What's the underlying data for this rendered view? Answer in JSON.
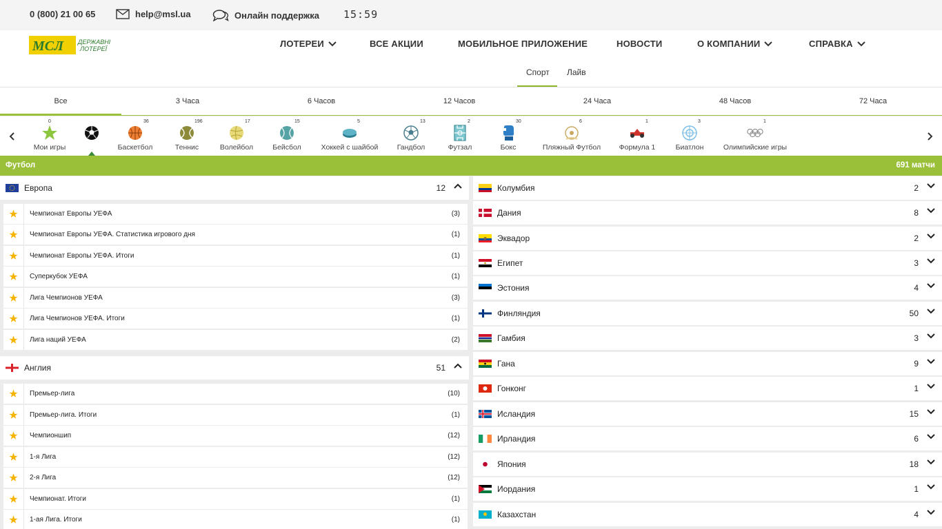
{
  "topbar": {
    "phone": "0 (800) 21 00 65",
    "email": "help@msl.ua",
    "support": "Онлайн поддержка",
    "time": "15:59"
  },
  "logo": {
    "mark": "МСЛ",
    "line1": "ДЕРЖАВНІ",
    "line2": "ЛОТЕРЕЇ"
  },
  "nav": {
    "lotteries": "ЛОТЕРЕИ",
    "promos": "ВСЕ АКЦИИ",
    "mobile": "МОБИЛЬНОЕ ПРИЛОЖЕНИЕ",
    "news": "НОВОСТИ",
    "company": "О КОМПАНИИ",
    "help": "СПРАВКА"
  },
  "modes": {
    "sport": "Спорт",
    "live": "Лайв"
  },
  "timeframes": [
    "Все",
    "3 Часа",
    "6 Часов",
    "12 Часов",
    "24 Часа",
    "48 Часов",
    "72 Часа"
  ],
  "sports": [
    {
      "label": "Мои игры",
      "count": "0",
      "icon": "star-icon"
    },
    {
      "label": "",
      "count": "",
      "icon": "soccer-ball-icon"
    },
    {
      "label": "Баскетбол",
      "count": "36",
      "icon": "basketball-icon"
    },
    {
      "label": "Теннис",
      "count": "196",
      "icon": "tennis-ball-icon"
    },
    {
      "label": "Волейбол",
      "count": "17",
      "icon": "volleyball-icon"
    },
    {
      "label": "Бейсбол",
      "count": "15",
      "icon": "baseball-icon"
    },
    {
      "label": "Хоккей с шайбой",
      "count": "5",
      "icon": "hockey-puck-icon"
    },
    {
      "label": "Гандбол",
      "count": "13",
      "icon": "handball-icon"
    },
    {
      "label": "Футзал",
      "count": "2",
      "icon": "futsal-icon"
    },
    {
      "label": "Бокс",
      "count": "30",
      "icon": "boxing-glove-icon"
    },
    {
      "label": "Пляжный Футбол",
      "count": "6",
      "icon": "beach-soccer-icon"
    },
    {
      "label": "Формула 1",
      "count": "1",
      "icon": "formula1-car-icon"
    },
    {
      "label": "Биатлон",
      "count": "3",
      "icon": "biathlon-target-icon"
    },
    {
      "label": "Олимпийские игры",
      "count": "1",
      "icon": "olympic-rings-icon"
    }
  ],
  "section": {
    "title": "Футбол",
    "total": "691 матчи"
  },
  "groups": [
    {
      "name": "Европа",
      "count": "12",
      "leagues": [
        {
          "name": "Чемпионат Европы УЕФА",
          "count": "(3)"
        },
        {
          "name": "Чемпионат Европы УЕФА. Статистика игрового дня",
          "count": "(1)"
        },
        {
          "name": "Чемпионат Европы УЕФА. Итоги",
          "count": "(1)"
        },
        {
          "name": "Суперкубок УЕФА",
          "count": "(1)"
        },
        {
          "name": "Лига Чемпионов УЕФА",
          "count": "(3)"
        },
        {
          "name": "Лига Чемпионов УЕФА. Итоги",
          "count": "(1)"
        },
        {
          "name": "Лига наций УЕФА",
          "count": "(2)"
        }
      ]
    },
    {
      "name": "Англия",
      "count": "51",
      "leagues": [
        {
          "name": "Премьер-лига",
          "count": "(10)"
        },
        {
          "name": "Премьер-лига. Итоги",
          "count": "(1)"
        },
        {
          "name": "Чемпионшип",
          "count": "(12)"
        },
        {
          "name": "1-я Лига",
          "count": "(12)"
        },
        {
          "name": "2-я Лига",
          "count": "(12)"
        },
        {
          "name": "Чемпионат. Итоги",
          "count": "(1)"
        },
        {
          "name": "1-ая Лига. Итоги",
          "count": "(1)"
        }
      ]
    }
  ],
  "countries": [
    {
      "name": "Колумбия",
      "count": "2"
    },
    {
      "name": "Дания",
      "count": "8"
    },
    {
      "name": "Эквадор",
      "count": "2"
    },
    {
      "name": "Египет",
      "count": "3"
    },
    {
      "name": "Эстония",
      "count": "4"
    },
    {
      "name": "Финляндия",
      "count": "50"
    },
    {
      "name": "Гамбия",
      "count": "3"
    },
    {
      "name": "Гана",
      "count": "9"
    },
    {
      "name": "Гонконг",
      "count": "1"
    },
    {
      "name": "Исландия",
      "count": "15"
    },
    {
      "name": "Ирландия",
      "count": "6"
    },
    {
      "name": "Япония",
      "count": "18"
    },
    {
      "name": "Иордания",
      "count": "1"
    },
    {
      "name": "Казахстан",
      "count": "4"
    }
  ],
  "colors": {
    "accent": "#9ac039",
    "star": "#f5b400"
  }
}
